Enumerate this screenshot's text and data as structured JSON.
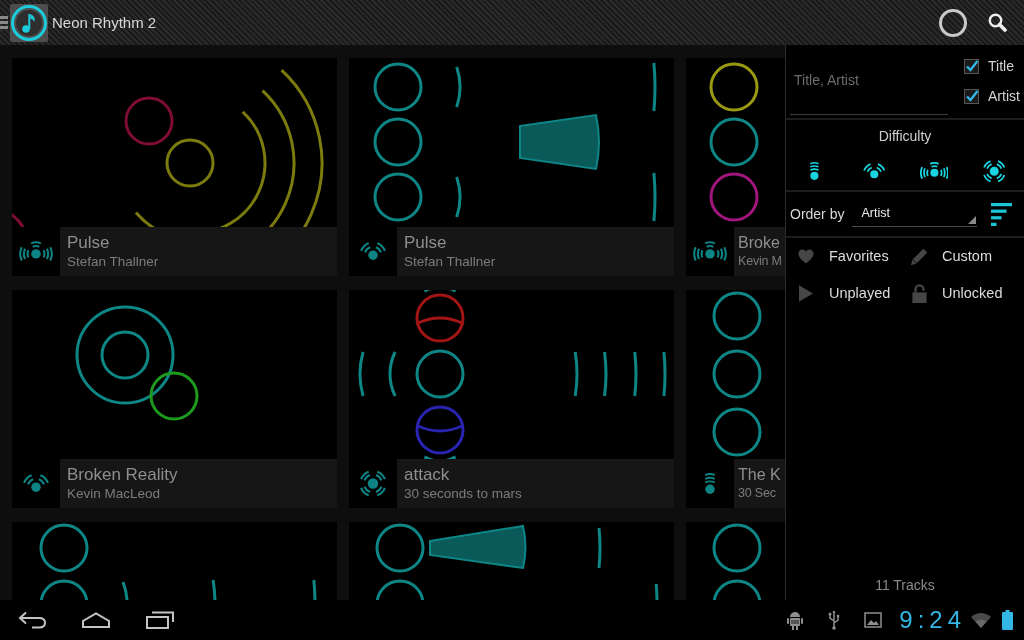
{
  "action_bar": {
    "title": "Neon Rhythm 2"
  },
  "tiles": [
    {
      "title": "Pulse",
      "artist": "Stefan Thallner",
      "kind": "hard"
    },
    {
      "title": "Pulse",
      "artist": "Stefan Thallner",
      "kind": "medium"
    },
    {
      "title": "Broke",
      "artist": "Kevin M",
      "kind": "hard"
    },
    {
      "title": "Broken Reality",
      "artist": "Kevin MacLeod",
      "kind": "medium"
    },
    {
      "title": "attack",
      "artist": "30 seconds to mars",
      "kind": "expert"
    },
    {
      "title": "The K",
      "artist": "30 Sec",
      "kind": "easy"
    }
  ],
  "filter_panel": {
    "search": {
      "placeholder": "Title, Artist"
    },
    "search_in": [
      {
        "label": "Title",
        "checked": true
      },
      {
        "label": "Artist",
        "checked": true
      }
    ],
    "difficulty": {
      "label": "Difficulty",
      "levels": [
        {
          "kind": "easy",
          "selected": true
        },
        {
          "kind": "medium",
          "selected": true
        },
        {
          "kind": "hard",
          "selected": true
        },
        {
          "kind": "expert",
          "selected": true
        }
      ]
    },
    "order_by": {
      "label": "Order by",
      "value": "Artist"
    },
    "toggles": [
      {
        "kind": "heart",
        "label": "Favorites",
        "selected": false
      },
      {
        "kind": "pencil",
        "label": "Custom",
        "selected": false
      },
      {
        "kind": "play",
        "label": "Unplayed",
        "selected": false
      },
      {
        "kind": "lock",
        "label": "Unlocked",
        "selected": false
      }
    ],
    "count": "11 Tracks"
  },
  "system_bar": {
    "time": "9:24"
  }
}
